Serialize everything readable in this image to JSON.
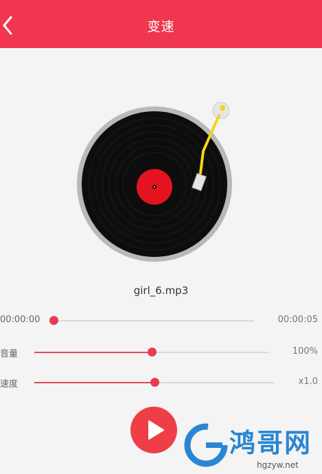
{
  "header": {
    "title": "变速",
    "bg_color": "#f0374f"
  },
  "player": {
    "filename": "girl_6.mp3",
    "disc_label_color": "#e3141f",
    "arm_color": "#f2d51a"
  },
  "progress": {
    "current_time": "00:00:00",
    "total_time": "00:00:05",
    "fraction": 0.0
  },
  "volume": {
    "label": "音量",
    "value_text": "100%",
    "fraction": 0.5
  },
  "speed": {
    "label": "速度",
    "value_text": "x1.0",
    "fraction": 0.5
  },
  "controls": {
    "play_icon": "play-icon",
    "play_color": "#ee3f48"
  },
  "watermark": {
    "text": "鸿哥网",
    "url": "hgzyw.net"
  }
}
